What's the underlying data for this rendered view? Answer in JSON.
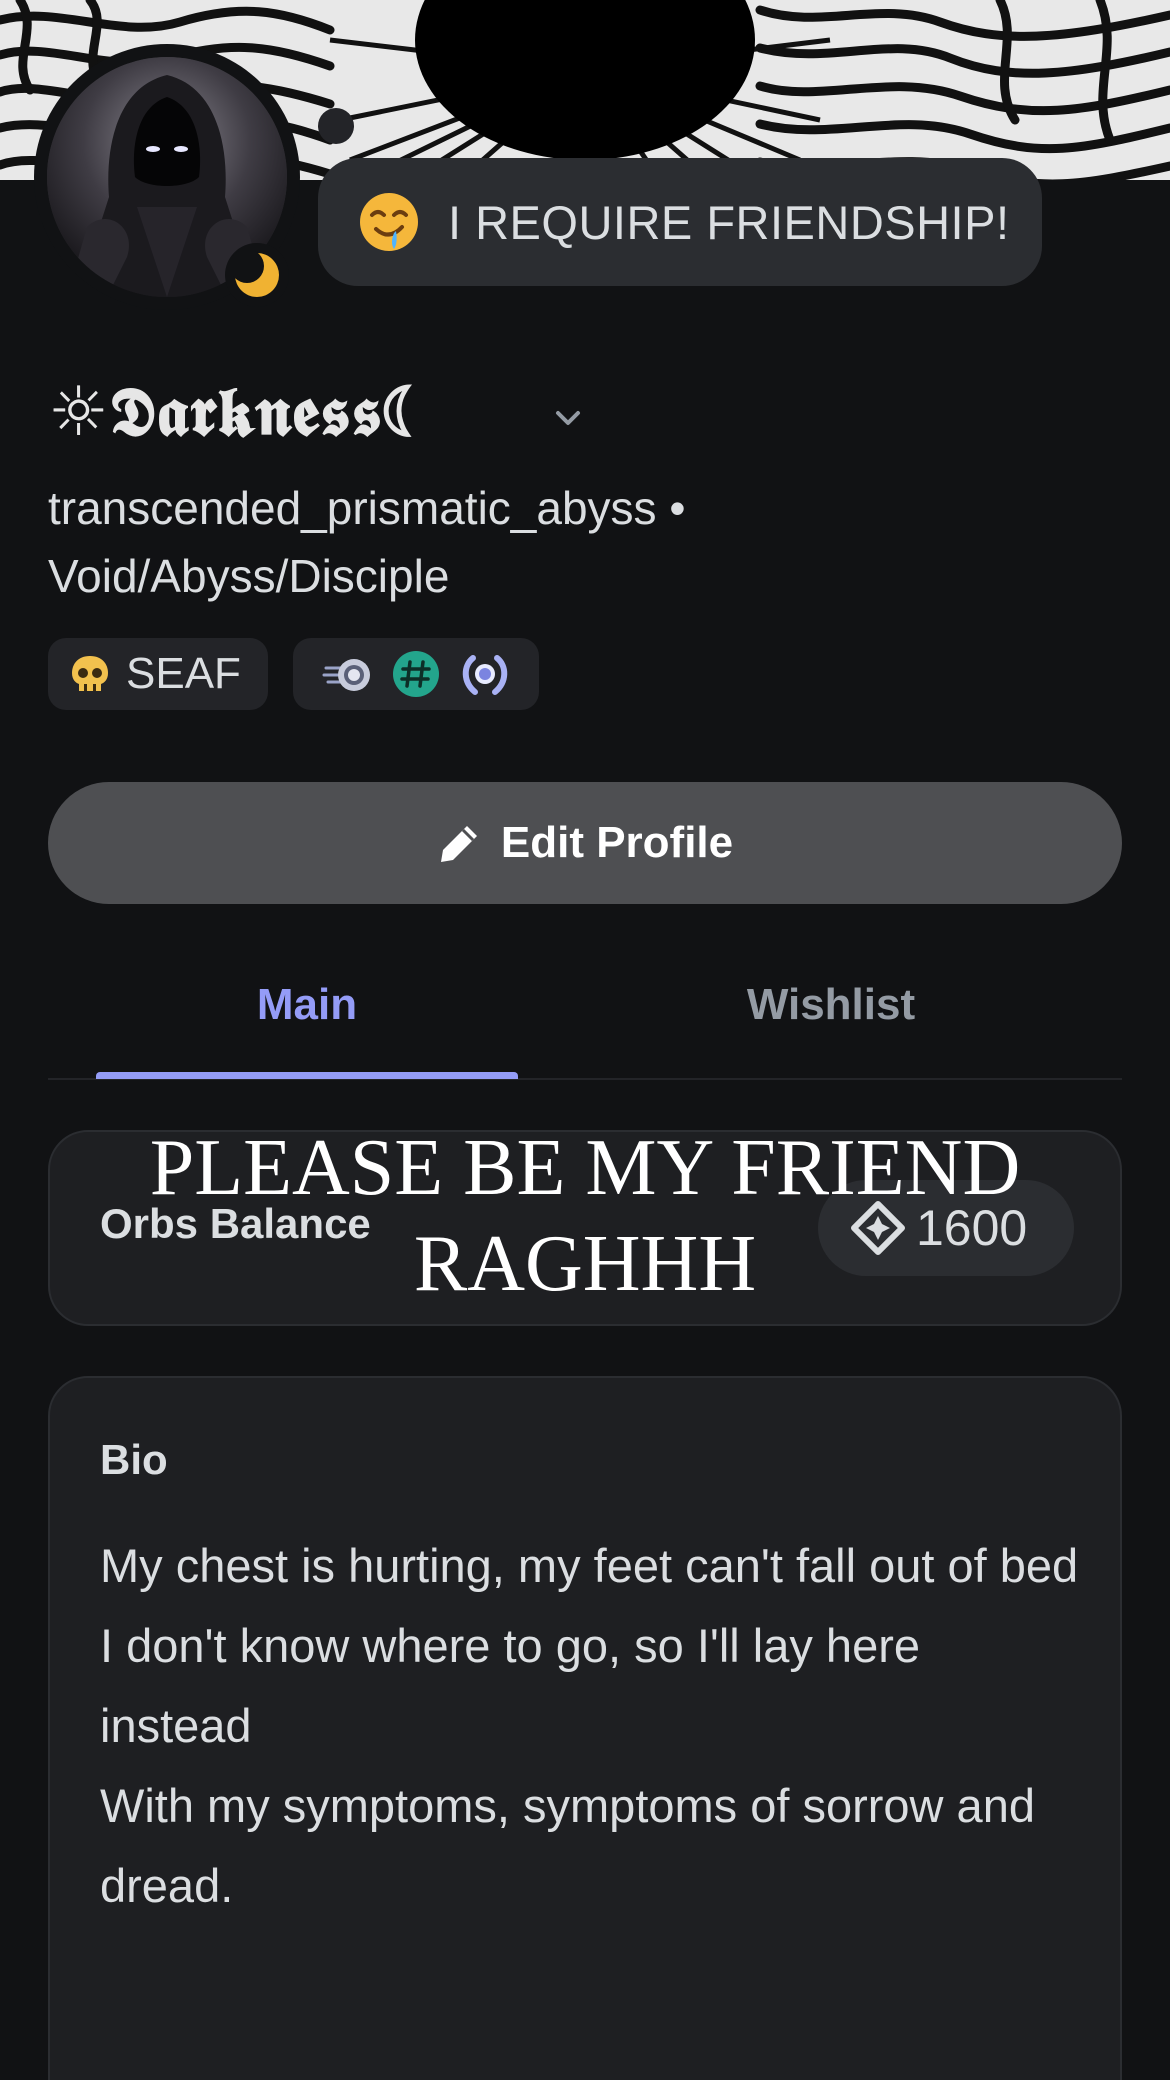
{
  "status": {
    "emoji": "drooling-face",
    "text": "I REQUIRE FRIENDSHIP!"
  },
  "profile": {
    "display_name": "☼𝕯𝖆𝖗𝖐𝖓𝖊𝖘𝖘☾",
    "username": "transcended_prismatic_abyss",
    "separator": "•",
    "pronouns": "Void/Abyss/Disciple",
    "presence": "idle",
    "presence_color": "#f0b232"
  },
  "tags": {
    "clan_tag": "SEAF",
    "clan_icon": "skull-icon",
    "badges": [
      "nitro-orb-badge",
      "hashtag-badge",
      "quest-laurel-badge"
    ]
  },
  "actions": {
    "edit_profile": "Edit Profile"
  },
  "tabs": [
    {
      "label": "Main",
      "active": true
    },
    {
      "label": "Wishlist",
      "active": false
    }
  ],
  "orbs": {
    "label": "Orbs Balance",
    "value": "1600"
  },
  "overlay_caption": "PLEASE BE MY FRIEND\nRAGHHH",
  "bio": {
    "title": "Bio",
    "lines": [
      "My chest is hurting, my feet can't fall out of bed",
      "I don't know where to go, so I'll lay here instead",
      "With my symptoms, symptoms of sorrow and dread."
    ]
  },
  "colors": {
    "accent": "#949cf7",
    "background": "#111214",
    "card": "#1e1f22"
  }
}
